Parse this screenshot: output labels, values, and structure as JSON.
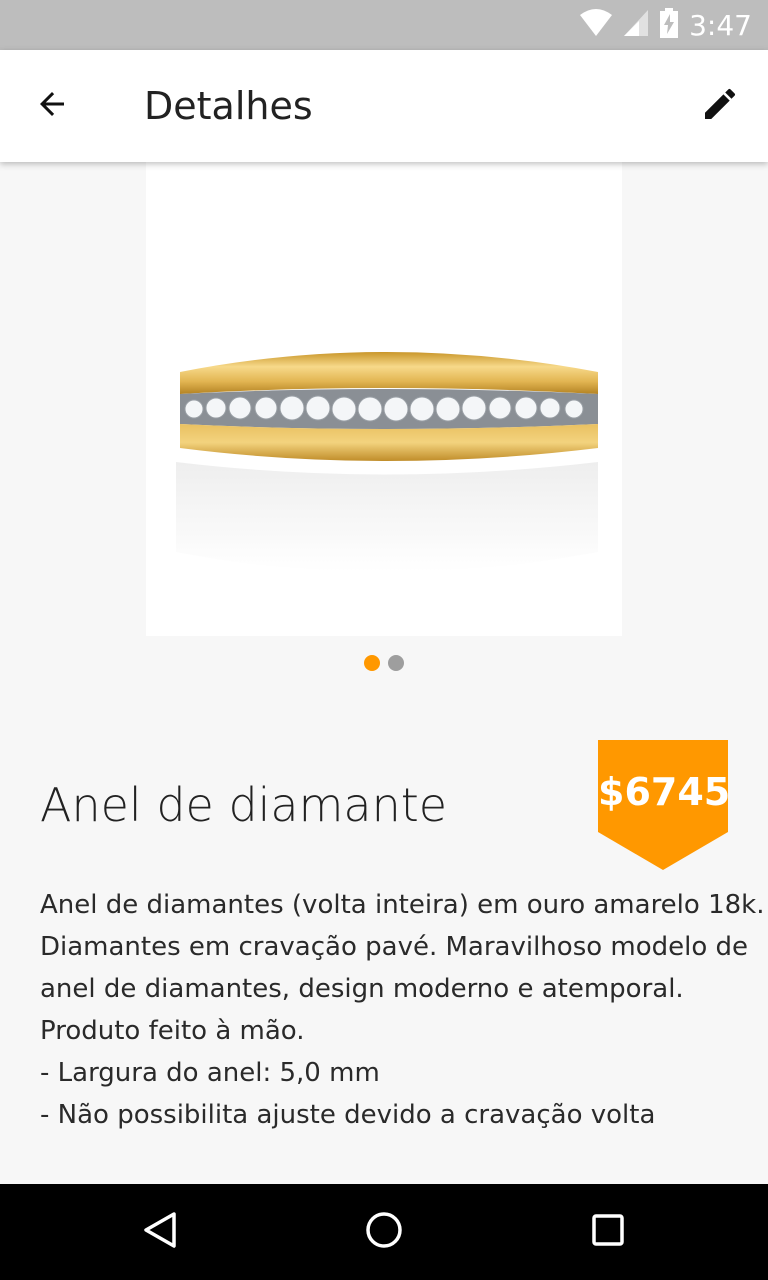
{
  "status_bar": {
    "time": "3:47",
    "icons": [
      "wifi-icon",
      "signal-icon",
      "battery-charging-icon"
    ]
  },
  "app_bar": {
    "title": "Detalhes",
    "back_icon": "arrow-back-icon",
    "edit_icon": "pencil-icon"
  },
  "carousel": {
    "page_count": 2,
    "active_page": 1,
    "active_color": "#ff9800",
    "inactive_color": "#9e9e9e"
  },
  "product": {
    "name": "Anel de diamante",
    "price": "$6745",
    "price_badge_color": "#ff9800",
    "description_lines": [
      "Anel de diamantes (volta inteira) em ouro amarelo 18k.",
      "Diamantes em cravação pavé. Maravilhoso modelo de",
      "anel de diamantes, design moderno e atemporal.",
      "Produto feito à mão.",
      "- Largura do anel: 5,0 mm",
      "- Não possibilita ajuste devido a cravação volta"
    ]
  },
  "nav_bar": {
    "buttons": [
      "back-triangle-icon",
      "home-circle-icon",
      "recents-square-icon"
    ]
  }
}
